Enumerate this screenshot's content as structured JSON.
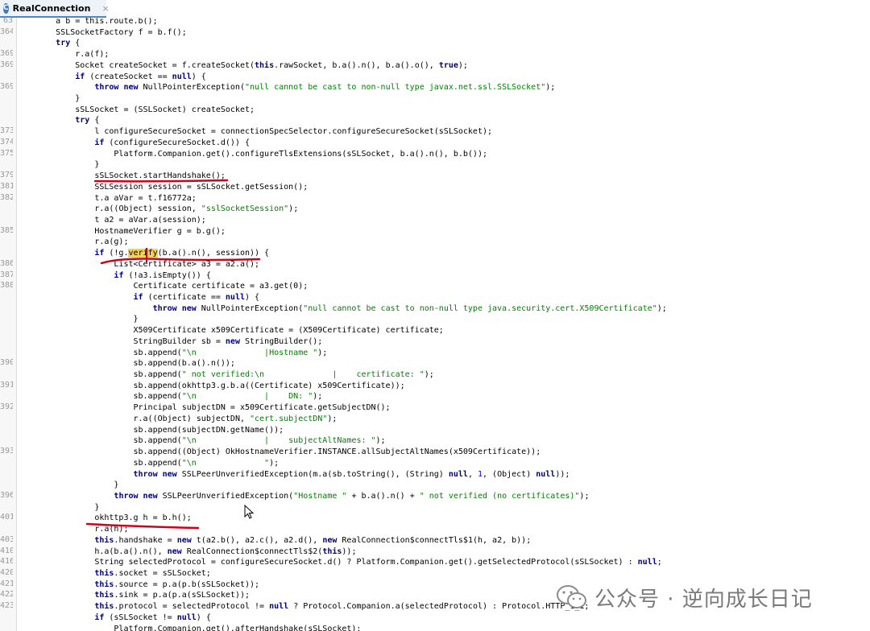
{
  "tab": {
    "icon_letter": "C",
    "label": "RealConnection",
    "close": "×"
  },
  "watermark": {
    "text": "公众号 · 逆向成长日记"
  },
  "annotation_color": "#d0021b",
  "highlight_color": "#fcf7c0",
  "lines": [
    {
      "ln": "63",
      "tokens": [
        {
          "t": "        a b = this.route.b();"
        }
      ]
    },
    {
      "ln": "364",
      "tokens": [
        {
          "t": "        SSLSocketFactory f = b.f();"
        }
      ]
    },
    {
      "ln": "",
      "tokens": [
        {
          "t": "        "
        },
        {
          "t": "try",
          "c": "kw"
        },
        {
          "t": " {"
        }
      ]
    },
    {
      "ln": "369",
      "tokens": [
        {
          "t": "            r.a(f);"
        }
      ]
    },
    {
      "ln": "369",
      "tokens": [
        {
          "t": "            Socket createSocket = f.createSocket("
        },
        {
          "t": "this",
          "c": "kw"
        },
        {
          "t": ".rawSocket, b.a().n(), b.a().o(), "
        },
        {
          "t": "true",
          "c": "kw"
        },
        {
          "t": ");"
        }
      ]
    },
    {
      "ln": "",
      "tokens": [
        {
          "t": "            "
        },
        {
          "t": "if",
          "c": "kw"
        },
        {
          "t": " (createSocket == "
        },
        {
          "t": "null",
          "c": "kw"
        },
        {
          "t": ") {"
        }
      ]
    },
    {
      "ln": "369",
      "tokens": [
        {
          "t": "                "
        },
        {
          "t": "throw new",
          "c": "kw"
        },
        {
          "t": " NullPointerException(",
          "c": "type"
        },
        {
          "t": "\"null cannot be cast to non-null type javax.net.ssl.SSLSocket\"",
          "c": "str"
        },
        {
          "t": ");"
        }
      ]
    },
    {
      "ln": "",
      "tokens": [
        {
          "t": "            }"
        }
      ]
    },
    {
      "ln": "",
      "tokens": [
        {
          "t": "            sSLSocket = (SSLSocket) createSocket;"
        }
      ]
    },
    {
      "ln": "",
      "tokens": [
        {
          "t": "            "
        },
        {
          "t": "try",
          "c": "kw"
        },
        {
          "t": " {"
        }
      ]
    },
    {
      "ln": "373",
      "tokens": [
        {
          "t": "                l configureSecureSocket = connectionSpecSelector.configureSecureSocket(sSLSocket);"
        }
      ]
    },
    {
      "ln": "374",
      "tokens": [
        {
          "t": "                "
        },
        {
          "t": "if",
          "c": "kw"
        },
        {
          "t": " (configureSecureSocket.d()) {"
        }
      ]
    },
    {
      "ln": "375",
      "tokens": [
        {
          "t": "                    Platform.Companion.get().configureTlsExtensions(sSLSocket, b.a().n(), b.b());"
        }
      ]
    },
    {
      "ln": "",
      "tokens": [
        {
          "t": "                }"
        }
      ]
    },
    {
      "ln": "379",
      "tokens": [
        {
          "t": "                sSLSocket.startHandshake();"
        }
      ]
    },
    {
      "ln": "381",
      "tokens": [
        {
          "t": "                SSLSession session = sSLSocket.getSession();"
        }
      ]
    },
    {
      "ln": "382",
      "tokens": [
        {
          "t": "                t.a aVar = t.f16772a;"
        }
      ]
    },
    {
      "ln": "",
      "tokens": [
        {
          "t": "                r.a(("
        },
        {
          "t": "Object",
          "c": "type"
        },
        {
          "t": ") session, "
        },
        {
          "t": "\"sslSocketSession\"",
          "c": "str"
        },
        {
          "t": ");"
        }
      ]
    },
    {
      "ln": "",
      "tokens": [
        {
          "t": "                t a2 = aVar.a(session);"
        }
      ]
    },
    {
      "ln": "385",
      "tokens": [
        {
          "t": "                HostnameVerifier g = b.g();"
        }
      ]
    },
    {
      "ln": "",
      "tokens": [
        {
          "t": "                r.a(g);"
        }
      ]
    },
    {
      "ln": "",
      "hl": true,
      "tokens": [
        {
          "t": "                "
        },
        {
          "t": "if",
          "c": "kw"
        },
        {
          "t": " (!g."
        },
        {
          "t": "verify",
          "c": "wm"
        },
        {
          "t": "(b.a().n(), session)) {"
        }
      ]
    },
    {
      "ln": "386",
      "tokens": [
        {
          "t": "                    List<Certificate> a3 = a2.a();"
        }
      ]
    },
    {
      "ln": "387",
      "tokens": [
        {
          "t": "                    "
        },
        {
          "t": "if",
          "c": "kw"
        },
        {
          "t": " (!a3.isEmpty()) {"
        }
      ]
    },
    {
      "ln": "388",
      "tokens": [
        {
          "t": "                        Certificate certificate = a3.get(0);"
        }
      ]
    },
    {
      "ln": "",
      "tokens": [
        {
          "t": "                        "
        },
        {
          "t": "if",
          "c": "kw"
        },
        {
          "t": " (certificate == "
        },
        {
          "t": "null",
          "c": "kw"
        },
        {
          "t": ") {"
        }
      ]
    },
    {
      "ln": "",
      "tokens": [
        {
          "t": "                            "
        },
        {
          "t": "throw new",
          "c": "kw"
        },
        {
          "t": " NullPointerException(",
          "c": "type"
        },
        {
          "t": "\"null cannot be cast to non-null type java.security.cert.X509Certificate\"",
          "c": "str"
        },
        {
          "t": ");"
        }
      ]
    },
    {
      "ln": "",
      "tokens": [
        {
          "t": "                        }"
        }
      ]
    },
    {
      "ln": "",
      "tokens": [
        {
          "t": "                        X509Certificate x509Certificate = (X509Certificate) certificate;"
        }
      ]
    },
    {
      "ln": "",
      "tokens": [
        {
          "t": "                        "
        },
        {
          "t": "StringBuilder",
          "c": "type"
        },
        {
          "t": " sb = "
        },
        {
          "t": "new",
          "c": "kw"
        },
        {
          "t": " StringBuilder();",
          "c": "type"
        }
      ]
    },
    {
      "ln": "",
      "tokens": [
        {
          "t": "                        sb.append("
        },
        {
          "t": "\"\\n              |Hostname \"",
          "c": "str"
        },
        {
          "t": ");"
        }
      ]
    },
    {
      "ln": "390",
      "tokens": [
        {
          "t": "                        sb.append(b.a().n());"
        }
      ]
    },
    {
      "ln": "",
      "tokens": [
        {
          "t": "                        sb.append("
        },
        {
          "t": "\" not verified:\\n              |    certificate: \"",
          "c": "str"
        },
        {
          "t": ");"
        }
      ]
    },
    {
      "ln": "391",
      "tokens": [
        {
          "t": "                        sb.append(okhttp3.g.b.a((Certificate) x509Certificate));"
        }
      ]
    },
    {
      "ln": "",
      "tokens": [
        {
          "t": "                        sb.append("
        },
        {
          "t": "\"\\n              |    DN: \"",
          "c": "str"
        },
        {
          "t": ");"
        }
      ]
    },
    {
      "ln": "392",
      "tokens": [
        {
          "t": "                        Principal subjectDN = x509Certificate.getSubjectDN();"
        }
      ]
    },
    {
      "ln": "",
      "tokens": [
        {
          "t": "                        r.a(("
        },
        {
          "t": "Object",
          "c": "type"
        },
        {
          "t": ") subjectDN, "
        },
        {
          "t": "\"cert.subjectDN\"",
          "c": "str"
        },
        {
          "t": ");"
        }
      ]
    },
    {
      "ln": "",
      "tokens": [
        {
          "t": "                        sb.append(subjectDN.getName());"
        }
      ]
    },
    {
      "ln": "",
      "tokens": [
        {
          "t": "                        sb.append("
        },
        {
          "t": "\"\\n              |    subjectAltNames: \"",
          "c": "str"
        },
        {
          "t": ");"
        }
      ]
    },
    {
      "ln": "393",
      "tokens": [
        {
          "t": "                        sb.append(("
        },
        {
          "t": "Object",
          "c": "type"
        },
        {
          "t": ") OkHostnameVerifier.INSTANCE.allSubjectAltNames(x509Certificate));"
        }
      ]
    },
    {
      "ln": "",
      "tokens": [
        {
          "t": "                        sb.append("
        },
        {
          "t": "\"\\n              \"",
          "c": "str"
        },
        {
          "t": ");"
        }
      ]
    },
    {
      "ln": "",
      "tokens": [
        {
          "t": "                        "
        },
        {
          "t": "throw new",
          "c": "kw"
        },
        {
          "t": " SSLPeerUnverifiedException(m.a(sb.toString(), ("
        },
        {
          "t": "String",
          "c": "type"
        },
        {
          "t": ") "
        },
        {
          "t": "null",
          "c": "kw"
        },
        {
          "t": ", "
        },
        {
          "t": "1",
          "c": "num"
        },
        {
          "t": ", ("
        },
        {
          "t": "Object",
          "c": "type"
        },
        {
          "t": ") "
        },
        {
          "t": "null",
          "c": "kw"
        },
        {
          "t": "));"
        }
      ]
    },
    {
      "ln": "",
      "tokens": [
        {
          "t": "                    }"
        }
      ]
    },
    {
      "ln": "396",
      "tokens": [
        {
          "t": "                    "
        },
        {
          "t": "throw new",
          "c": "kw"
        },
        {
          "t": " SSLPeerUnverifiedException("
        },
        {
          "t": "\"Hostname \"",
          "c": "str"
        },
        {
          "t": " + b.a().n() + "
        },
        {
          "t": "\" not verified (no certificates)\"",
          "c": "str"
        },
        {
          "t": ");"
        }
      ]
    },
    {
      "ln": "",
      "tokens": [
        {
          "t": "                }"
        }
      ]
    },
    {
      "ln": "401",
      "tokens": [
        {
          "t": "                okhttp3.g h = b.h();"
        }
      ]
    },
    {
      "ln": "",
      "tokens": [
        {
          "t": "                r.a(h);"
        }
      ]
    },
    {
      "ln": "403",
      "tokens": [
        {
          "t": "                "
        },
        {
          "t": "this",
          "c": "kw"
        },
        {
          "t": ".handshake = "
        },
        {
          "t": "new",
          "c": "kw"
        },
        {
          "t": " t(a2.b(), a2.c(), a2.d(), "
        },
        {
          "t": "new",
          "c": "kw"
        },
        {
          "t": " RealConnection$connectTls$1(h, a2, b));"
        }
      ]
    },
    {
      "ln": "410",
      "tokens": [
        {
          "t": "                h.a(b.a().n(), "
        },
        {
          "t": "new",
          "c": "kw"
        },
        {
          "t": " RealConnection$connectTls$2("
        },
        {
          "t": "this",
          "c": "kw"
        },
        {
          "t": "));"
        }
      ]
    },
    {
      "ln": "416",
      "tokens": [
        {
          "t": "                "
        },
        {
          "t": "String",
          "c": "type"
        },
        {
          "t": " selectedProtocol = configureSecureSocket.d() ? Platform.Companion.get().getSelectedProtocol(sSLSocket) : "
        },
        {
          "t": "null",
          "c": "kw"
        },
        {
          "t": ";"
        }
      ]
    },
    {
      "ln": "420",
      "tokens": [
        {
          "t": "                "
        },
        {
          "t": "this",
          "c": "kw"
        },
        {
          "t": ".socket = sSLSocket;"
        }
      ]
    },
    {
      "ln": "421",
      "tokens": [
        {
          "t": "                "
        },
        {
          "t": "this",
          "c": "kw"
        },
        {
          "t": ".source = p.a(p.b(sSLSocket));"
        }
      ]
    },
    {
      "ln": "422",
      "tokens": [
        {
          "t": "                "
        },
        {
          "t": "this",
          "c": "kw"
        },
        {
          "t": ".sink = p.a(p.a(sSLSocket));"
        }
      ]
    },
    {
      "ln": "423",
      "tokens": [
        {
          "t": "                "
        },
        {
          "t": "this",
          "c": "kw"
        },
        {
          "t": ".protocol = selectedProtocol != "
        },
        {
          "t": "null",
          "c": "kw"
        },
        {
          "t": " ? Protocol.Companion.a(selectedProtocol) : Protocol.HTTP_1_1;"
        }
      ]
    },
    {
      "ln": "",
      "tokens": [
        {
          "t": "                "
        },
        {
          "t": "if",
          "c": "kw"
        },
        {
          "t": " (sSLSocket != "
        },
        {
          "t": "null",
          "c": "kw"
        },
        {
          "t": ") {"
        }
      ]
    },
    {
      "ln": "",
      "tokens": [
        {
          "t": "                    Platform.Companion.get().afterHandshake(sSLSocket);"
        }
      ]
    }
  ]
}
